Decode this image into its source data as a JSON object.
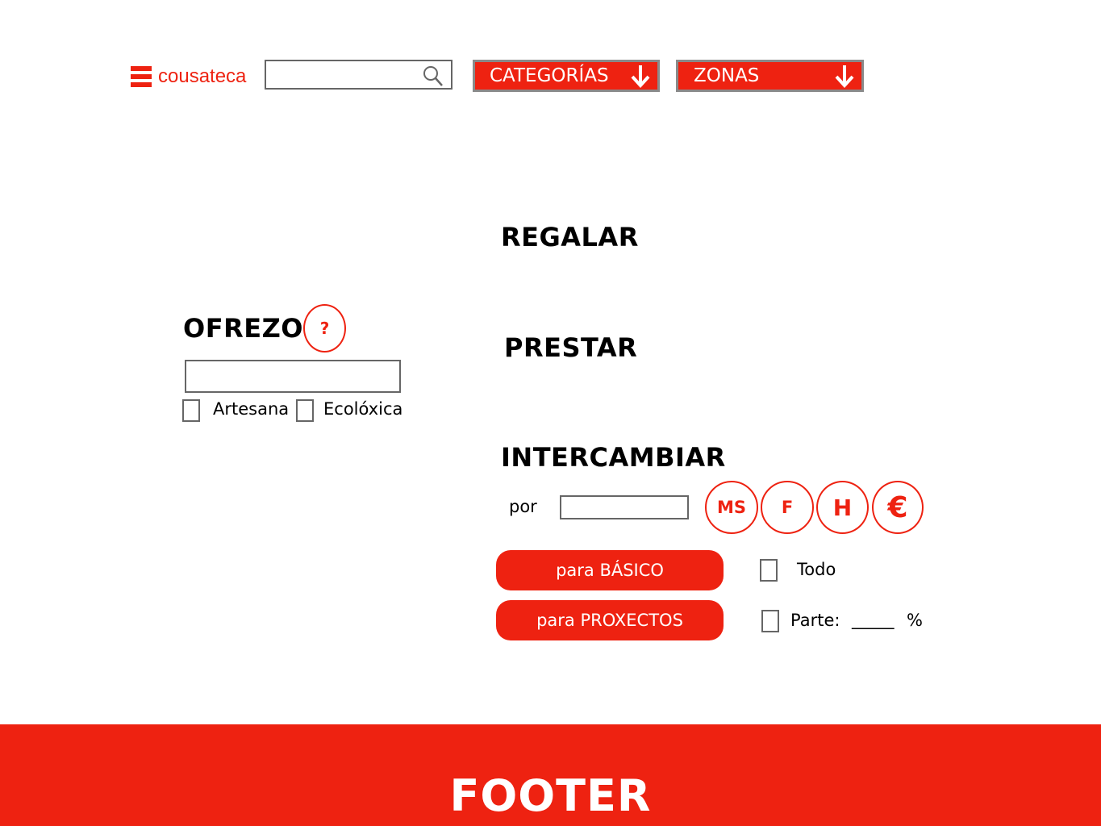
{
  "header": {
    "logo_text": "cousateca",
    "search": {
      "value": "",
      "placeholder": ""
    },
    "categories_label": "CATEGORÍAS",
    "zones_label": "ZONAS"
  },
  "offer": {
    "title": "OFREZO",
    "help_label": "?",
    "input": {
      "value": ""
    },
    "checkboxes": [
      {
        "label": "Artesana",
        "checked": false
      },
      {
        "label": "Ecolóxica",
        "checked": false
      }
    ]
  },
  "modes": {
    "gift": "REGALAR",
    "lend": "PRESTAR",
    "exchange": "INTERCAMBIAR"
  },
  "exchange": {
    "por_label": "por",
    "por_value": "",
    "currency_buttons": [
      "MS",
      "F",
      "H",
      "€"
    ],
    "basic_button": "para BÁSICO",
    "projects_button": "para PROXECTOS",
    "all_label": "Todo",
    "part_label": "Parte:",
    "part_value": "_____",
    "percent_sign": "%"
  },
  "footer": {
    "text": "FOOTER"
  },
  "colors": {
    "accent": "#ee2211",
    "border": "#666666",
    "dropdown_border": "#8a8a8a"
  },
  "icons": {
    "search": "magnifier-icon",
    "dropdown": "arrow-down-icon",
    "menu": "menu-icon"
  }
}
